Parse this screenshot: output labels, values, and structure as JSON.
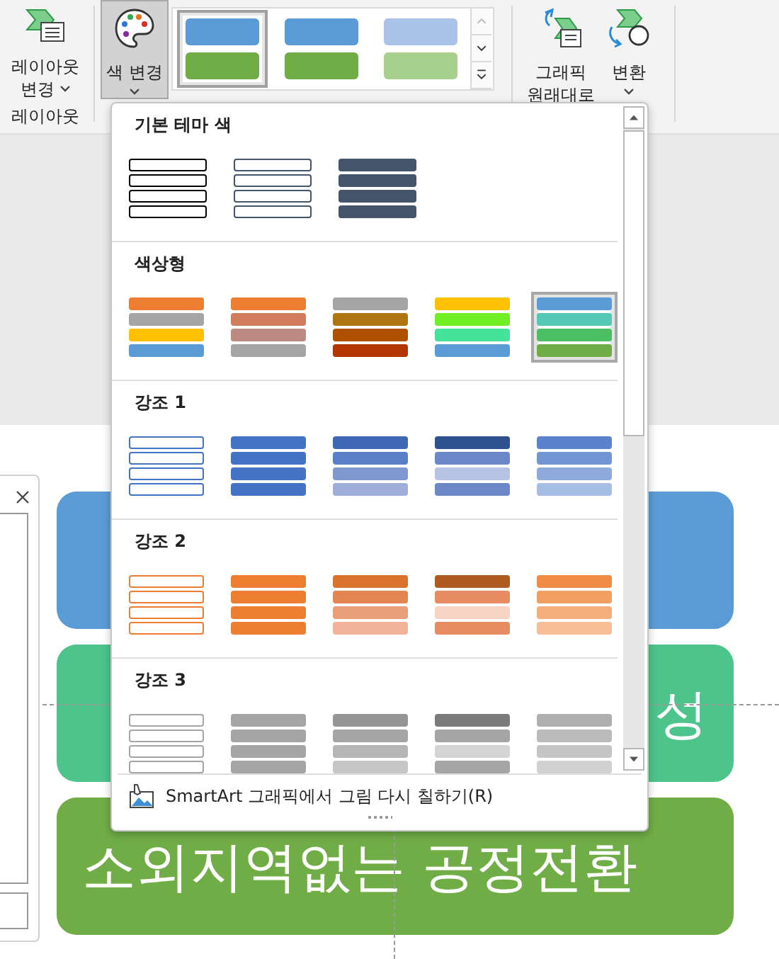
{
  "ribbon": {
    "layout_button": {
      "lines": [
        "레이아웃",
        "변경"
      ],
      "dropdown": true
    },
    "layout_group_label": "레이아웃",
    "recolor_button": {
      "lines": [
        "색 변경"
      ],
      "dropdown": true,
      "pressed": true
    },
    "style_gallery": [
      {
        "bars": [
          {
            "color": "#5b9bd5"
          },
          {
            "color": "#70ad47"
          }
        ],
        "selected": true
      },
      {
        "bars": [
          {
            "color": "#5b9bd5"
          },
          {
            "color": "#70ad47"
          }
        ],
        "selected": false
      },
      {
        "bars": [
          {
            "color": "#a9c4e8"
          },
          {
            "color": "#a8d08d"
          }
        ],
        "selected": false
      }
    ],
    "reset_button": {
      "lines": [
        "그래픽",
        "원래대로"
      ]
    },
    "convert_button": {
      "lines": [
        "변환"
      ],
      "dropdown": true
    }
  },
  "slide": {
    "shapes": [
      {
        "color": "#5b9bd5"
      },
      {
        "color": "#4dc48b",
        "right_text": "성"
      },
      {
        "color": "#70ad47",
        "left_text": "소외지역없는 공정전환"
      }
    ]
  },
  "color_menu": {
    "sections": [
      {
        "title": "기본 테마 색",
        "swatches": [
          {
            "kind": "outline",
            "bars": [
              {
                "color": "#000000"
              },
              {
                "color": "#000000"
              },
              {
                "color": "#000000"
              },
              {
                "color": "#000000"
              }
            ],
            "selected": false
          },
          {
            "kind": "outline",
            "bars": [
              {
                "color": "#44546a"
              },
              {
                "color": "#44546a"
              },
              {
                "color": "#44546a"
              },
              {
                "color": "#44546a"
              }
            ],
            "selected": false
          },
          {
            "kind": "fill",
            "bars": [
              {
                "color": "#44546a"
              },
              {
                "color": "#44546a"
              },
              {
                "color": "#44546a"
              },
              {
                "color": "#44546a"
              }
            ],
            "selected": false
          }
        ]
      },
      {
        "title": "색상형",
        "swatches": [
          {
            "kind": "fill",
            "bars": [
              {
                "color": "#ed7d31"
              },
              {
                "color": "#a5a5a5"
              },
              {
                "color": "#ffc000"
              },
              {
                "color": "#5b9bd5"
              }
            ],
            "selected": false
          },
          {
            "kind": "fill",
            "bars": [
              {
                "color": "#ed7d31"
              },
              {
                "color": "#d27c5e"
              },
              {
                "color": "#bc8a80"
              },
              {
                "color": "#a5a5a5"
              }
            ],
            "selected": false
          },
          {
            "kind": "fill",
            "bars": [
              {
                "color": "#a5a5a5"
              },
              {
                "color": "#ae7511"
              },
              {
                "color": "#ae5000"
              },
              {
                "color": "#b33500"
              }
            ],
            "selected": false
          },
          {
            "kind": "fill",
            "bars": [
              {
                "color": "#ffc000"
              },
              {
                "color": "#6fef24"
              },
              {
                "color": "#44e39a"
              },
              {
                "color": "#5b9bd5"
              }
            ],
            "selected": false
          },
          {
            "kind": "fill",
            "bars": [
              {
                "color": "#5b9bd5"
              },
              {
                "color": "#54c8b4"
              },
              {
                "color": "#4cbe64"
              },
              {
                "color": "#70ad47"
              }
            ],
            "selected": true
          }
        ]
      },
      {
        "title": "강조 1",
        "swatches": [
          {
            "kind": "outline",
            "bars": [
              {
                "color": "#4472c4"
              },
              {
                "color": "#4472c4"
              },
              {
                "color": "#4472c4"
              },
              {
                "color": "#4472c4"
              }
            ],
            "selected": false
          },
          {
            "kind": "fill",
            "bars": [
              {
                "color": "#4472c4"
              },
              {
                "color": "#4472c4"
              },
              {
                "color": "#4472c4"
              },
              {
                "color": "#4472c4"
              }
            ],
            "selected": false
          },
          {
            "kind": "fill",
            "bars": [
              {
                "color": "#3e68b3"
              },
              {
                "color": "#5a7fc6"
              },
              {
                "color": "#7e98cf"
              },
              {
                "color": "#9eaed9"
              }
            ],
            "selected": false
          },
          {
            "kind": "fill",
            "bars": [
              {
                "color": "#2f528f"
              },
              {
                "color": "#6c87c8"
              },
              {
                "color": "#b7c3e4"
              },
              {
                "color": "#6c87c8"
              }
            ],
            "selected": false
          },
          {
            "kind": "fill",
            "bars": [
              {
                "color": "#5a83cb"
              },
              {
                "color": "#7296d3"
              },
              {
                "color": "#8eaadc"
              },
              {
                "color": "#a6bde4"
              }
            ],
            "selected": false
          }
        ]
      },
      {
        "title": "강조 2",
        "swatches": [
          {
            "kind": "outline",
            "bars": [
              {
                "color": "#ed7d31"
              },
              {
                "color": "#ed7d31"
              },
              {
                "color": "#ed7d31"
              },
              {
                "color": "#ed7d31"
              }
            ],
            "selected": false
          },
          {
            "kind": "fill",
            "bars": [
              {
                "color": "#ed7d31"
              },
              {
                "color": "#ed7d31"
              },
              {
                "color": "#ed7d31"
              },
              {
                "color": "#ed7d31"
              }
            ],
            "selected": false
          },
          {
            "kind": "fill",
            "bars": [
              {
                "color": "#d9722c"
              },
              {
                "color": "#e38551"
              },
              {
                "color": "#eb9f79"
              },
              {
                "color": "#f3b29a"
              }
            ],
            "selected": false
          },
          {
            "kind": "fill",
            "bars": [
              {
                "color": "#ae5a21"
              },
              {
                "color": "#e68b62"
              },
              {
                "color": "#f8d3c3"
              },
              {
                "color": "#e68b62"
              }
            ],
            "selected": false
          },
          {
            "kind": "fill",
            "bars": [
              {
                "color": "#f08c45"
              },
              {
                "color": "#f29e62"
              },
              {
                "color": "#f4ae7c"
              },
              {
                "color": "#f6bd96"
              }
            ],
            "selected": false
          }
        ]
      },
      {
        "title": "강조 3",
        "swatches": [
          {
            "kind": "outline",
            "bars": [
              {
                "color": "#a5a5a5"
              },
              {
                "color": "#a5a5a5"
              },
              {
                "color": "#a5a5a5"
              },
              {
                "color": "#a5a5a5"
              }
            ],
            "selected": false
          },
          {
            "kind": "fill",
            "bars": [
              {
                "color": "#a5a5a5"
              },
              {
                "color": "#a5a5a5"
              },
              {
                "color": "#a5a5a5"
              },
              {
                "color": "#a5a5a5"
              }
            ],
            "selected": false
          },
          {
            "kind": "fill",
            "bars": [
              {
                "color": "#959595"
              },
              {
                "color": "#a5a5a5"
              },
              {
                "color": "#b5b5b5"
              },
              {
                "color": "#c6c6c6"
              }
            ],
            "selected": false
          },
          {
            "kind": "fill",
            "bars": [
              {
                "color": "#7b7b7b"
              },
              {
                "color": "#a5a5a5"
              },
              {
                "color": "#d4d4d4"
              },
              {
                "color": "#a5a5a5"
              }
            ],
            "selected": false
          },
          {
            "kind": "fill",
            "bars": [
              {
                "color": "#afafaf"
              },
              {
                "color": "#bababa"
              },
              {
                "color": "#c5c5c5"
              },
              {
                "color": "#d1d1d1"
              }
            ],
            "selected": false
          }
        ]
      }
    ],
    "footer_item": "SmartArt 그래픽에서 그림 다시 칠하기(R)"
  }
}
